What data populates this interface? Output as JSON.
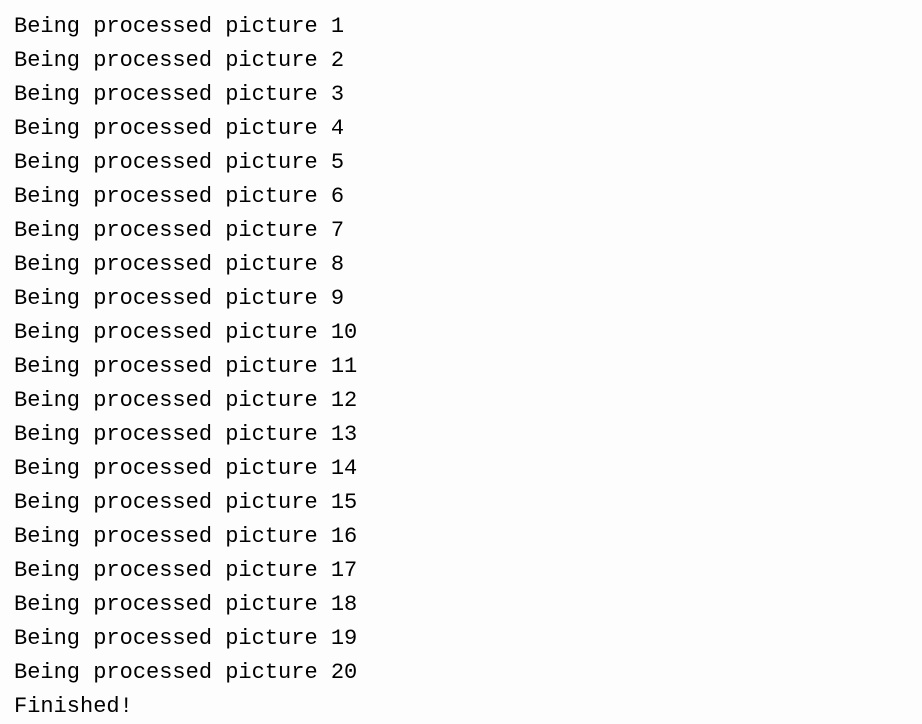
{
  "console": {
    "lines": [
      "Being processed picture 1",
      "Being processed picture 2",
      "Being processed picture 3",
      "Being processed picture 4",
      "Being processed picture 5",
      "Being processed picture 6",
      "Being processed picture 7",
      "Being processed picture 8",
      "Being processed picture 9",
      "Being processed picture 10",
      "Being processed picture 11",
      "Being processed picture 12",
      "Being processed picture 13",
      "Being processed picture 14",
      "Being processed picture 15",
      "Being processed picture 16",
      "Being processed picture 17",
      "Being processed picture 18",
      "Being processed picture 19",
      "Being processed picture 20",
      "Finished!"
    ]
  }
}
